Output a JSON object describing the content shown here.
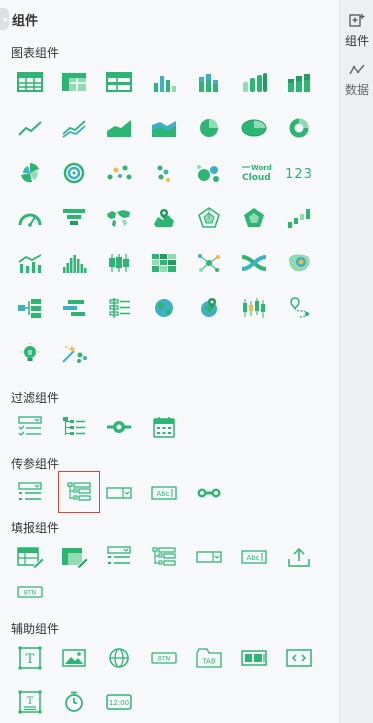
{
  "panel": {
    "title": "组件"
  },
  "sections": {
    "charts": "图表组件",
    "filter": "过滤组件",
    "param": "传参组件",
    "fill": "填报组件",
    "aux": "辅助组件"
  },
  "icons": {
    "word_cloud_line1": "Word",
    "word_cloud_line2": "Cloud",
    "number": "123",
    "label": "Abc",
    "btn": "BTN",
    "tab": "TAB",
    "clock": "12:00",
    "text": "T"
  },
  "rail": {
    "components": "组件",
    "data": "数据"
  },
  "colors": {
    "accent": "#2bb673",
    "accent_dark": "#1f9e5f",
    "accent_light": "#8fdcb2",
    "selected_border": "#d8453b"
  }
}
